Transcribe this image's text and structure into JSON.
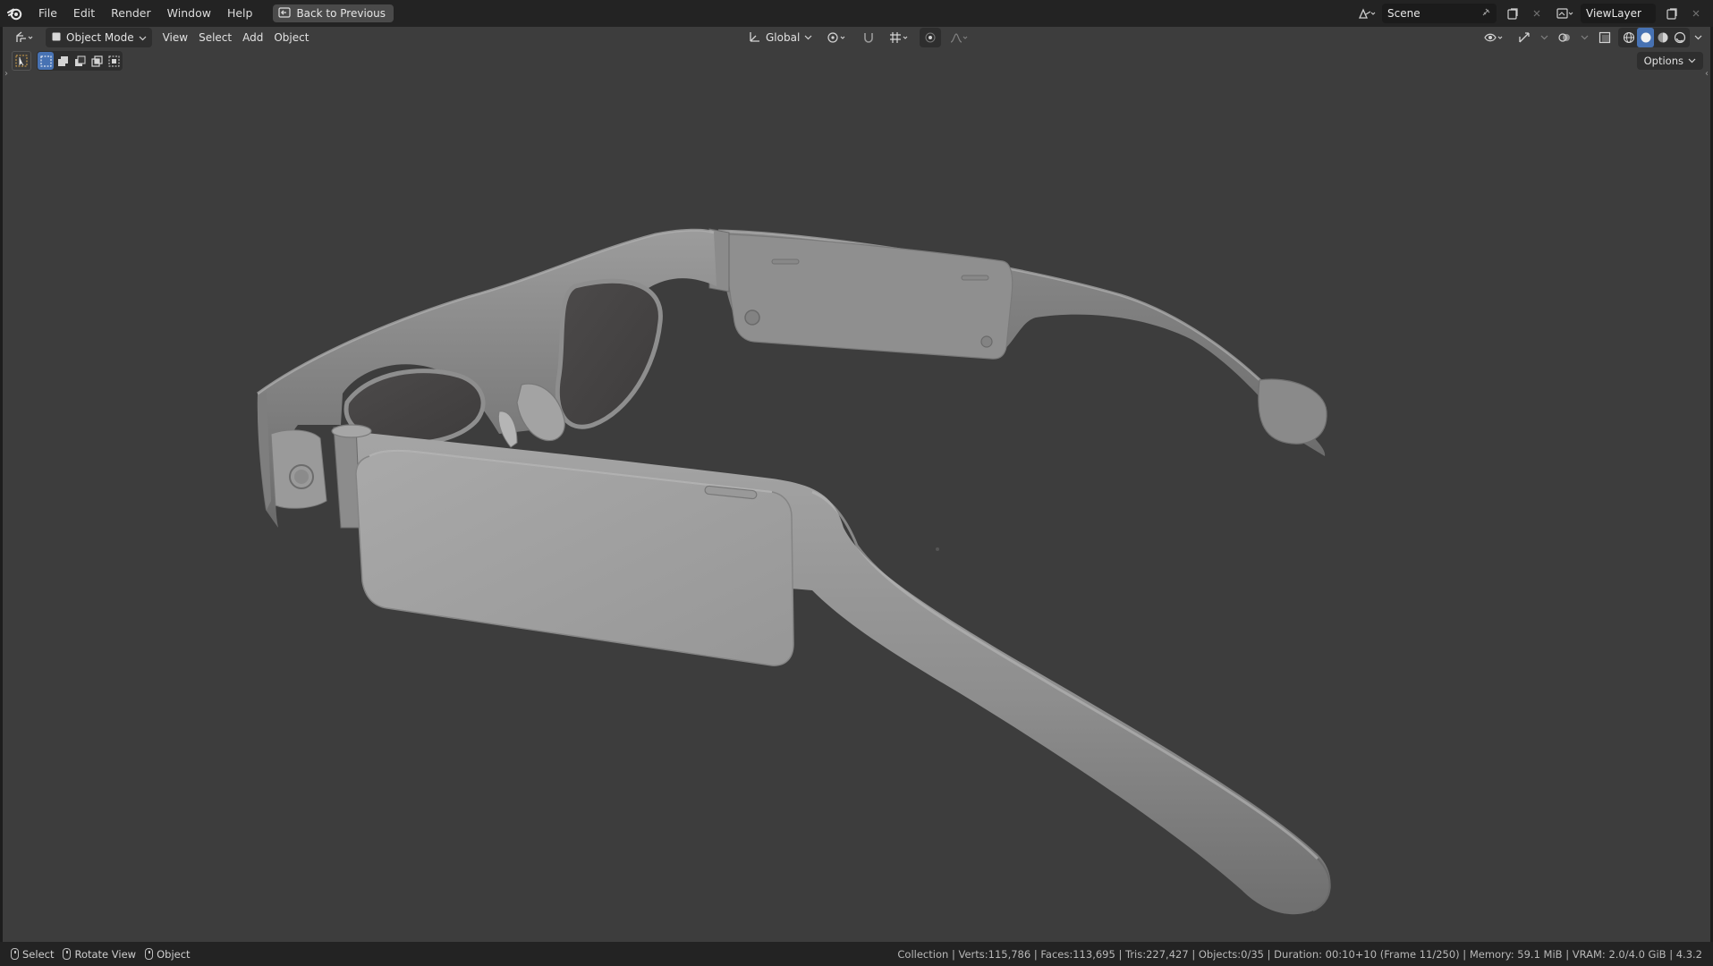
{
  "menu": {
    "items": [
      "File",
      "Edit",
      "Render",
      "Window",
      "Help"
    ],
    "back_button": "Back to Previous"
  },
  "top_right": {
    "scene_name": "Scene",
    "view_layer": "ViewLayer"
  },
  "viewport_header": {
    "mode": "Object Mode",
    "menus": [
      "View",
      "Select",
      "Add",
      "Object"
    ],
    "transform_orientation": "Global",
    "options_label": "Options",
    "active_shading": "solid"
  },
  "status": {
    "hints": [
      {
        "label": "Select"
      },
      {
        "label": "Rotate View"
      },
      {
        "label": "Object"
      }
    ],
    "info": "Collection | Verts:115,786 | Faces:113,695 | Tris:227,427 | Objects:0/35 | Duration: 00:10+10 (Frame 11/250) | Memory: 59.1 MiB | VRAM: 2.0/4.0 GiB | 4.3.2"
  },
  "icons": {
    "logo": "blender-logo-icon",
    "back": "back-to-previous-icon",
    "scene": "scene-icon",
    "view_layer": "view-layer-icon"
  }
}
